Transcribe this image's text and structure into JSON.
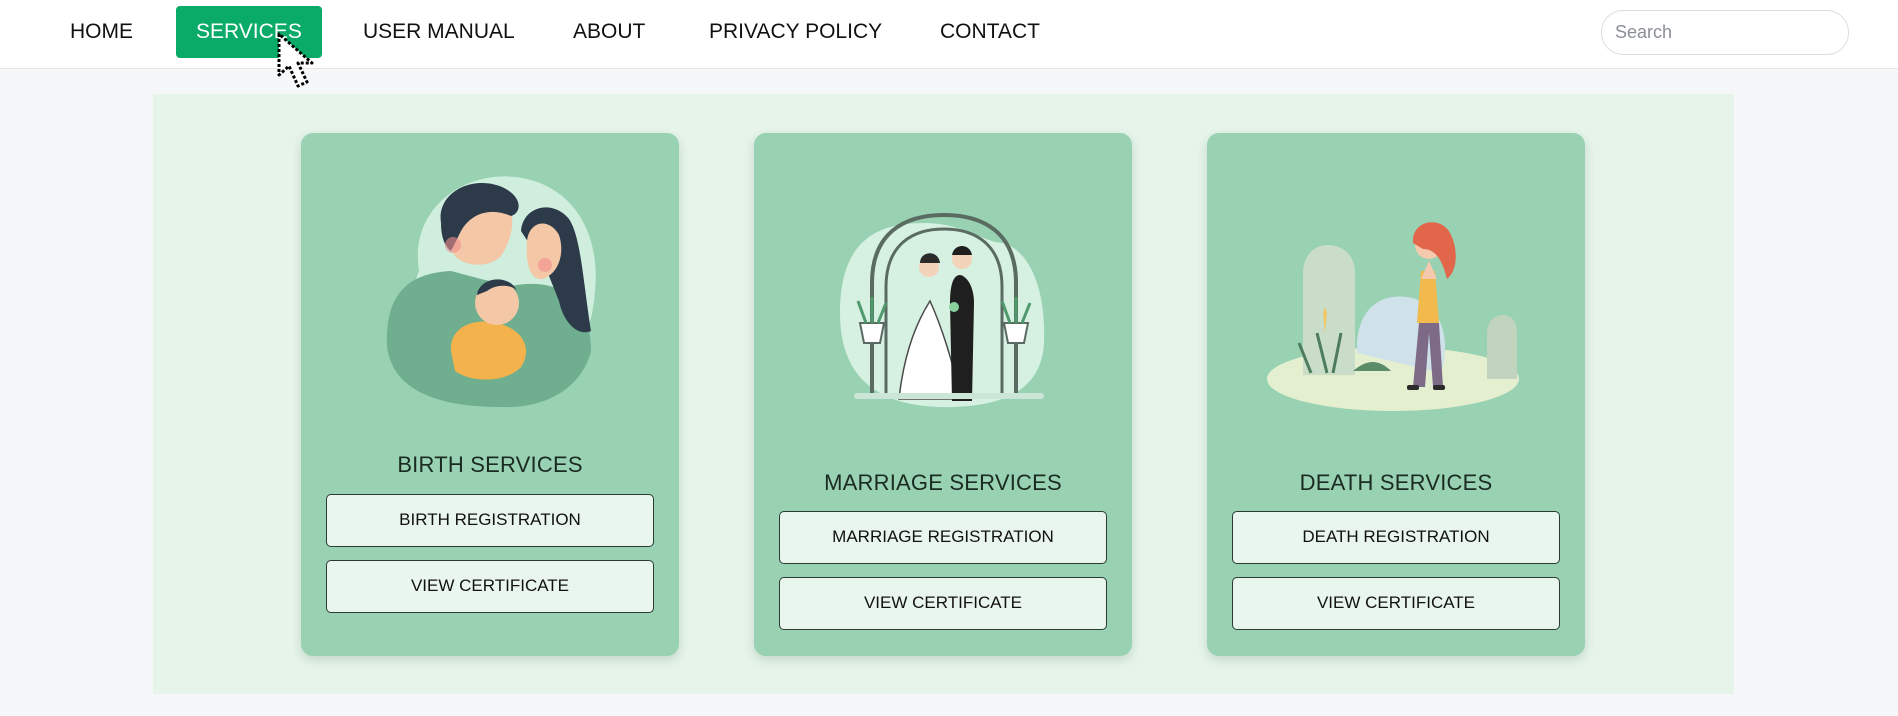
{
  "nav": {
    "items": [
      "HOME",
      "SERVICES",
      "USER MANUAL",
      "ABOUT",
      "PRIVACY POLICY",
      "CONTACT"
    ],
    "active": "SERVICES"
  },
  "search": {
    "placeholder": "Search",
    "value": ""
  },
  "cards": [
    {
      "title": "BIRTH SERVICES",
      "primary_button": "BIRTH REGISTRATION",
      "secondary_button": "VIEW CERTIFICATE"
    },
    {
      "title": "MARRIAGE SERVICES",
      "primary_button": "MARRIAGE REGISTRATION",
      "secondary_button": "VIEW CERTIFICATE"
    },
    {
      "title": "DEATH SERVICES",
      "primary_button": "DEATH REGISTRATION",
      "secondary_button": "VIEW CERTIFICATE"
    }
  ],
  "colors": {
    "accent": "#0aab68",
    "card_bg": "#98d2b2",
    "panel_bg": "#e6f4ea",
    "button_bg": "#e9f6ee"
  },
  "icons": {
    "card_0": "family-with-baby-illustration",
    "card_1": "wedding-couple-arch-illustration",
    "card_2": "mourning-woman-gravestone-illustration",
    "pointer": "mouse-cursor-icon"
  }
}
